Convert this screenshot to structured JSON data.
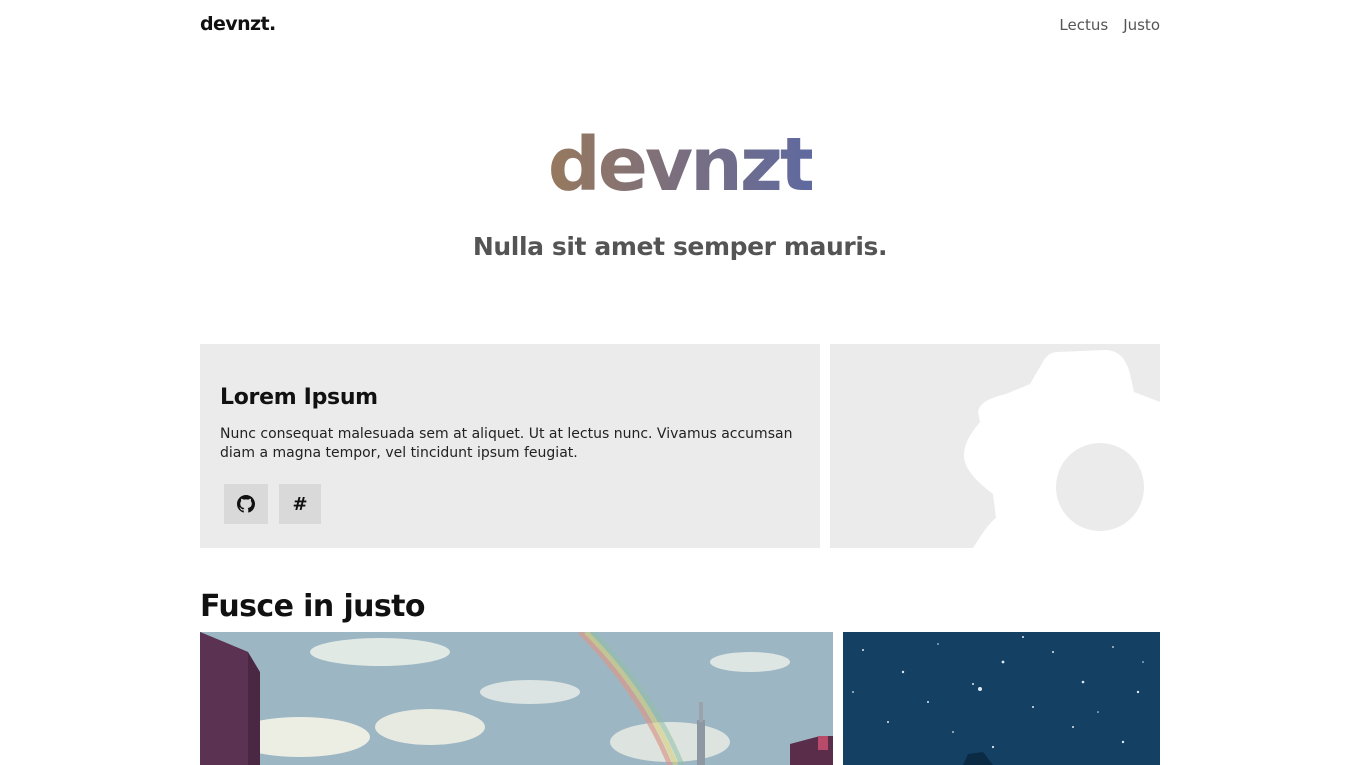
{
  "nav": {
    "brand": "devnzt.",
    "links": [
      "Lectus",
      "Justo"
    ]
  },
  "hero": {
    "title": "devnzt",
    "subtitle": "Nulla sit amet semper mauris."
  },
  "card": {
    "title": "Lorem Ipsum",
    "text": "Nunc consequat malesuada sem at aliquet. Ut at lectus nunc. Vivamus accumsan diam a magna tempor, vel tincidunt ipsum feugiat.",
    "buttons": [
      {
        "icon": "github-icon"
      },
      {
        "icon": "hash-icon",
        "label": "#"
      }
    ]
  },
  "section": {
    "title": "Fusce in justo"
  },
  "colors": {
    "gradient_start": "#97795d",
    "gradient_end": "#5f6aa0",
    "card_bg": "#ebebeb",
    "button_bg": "#d9d9d9"
  }
}
